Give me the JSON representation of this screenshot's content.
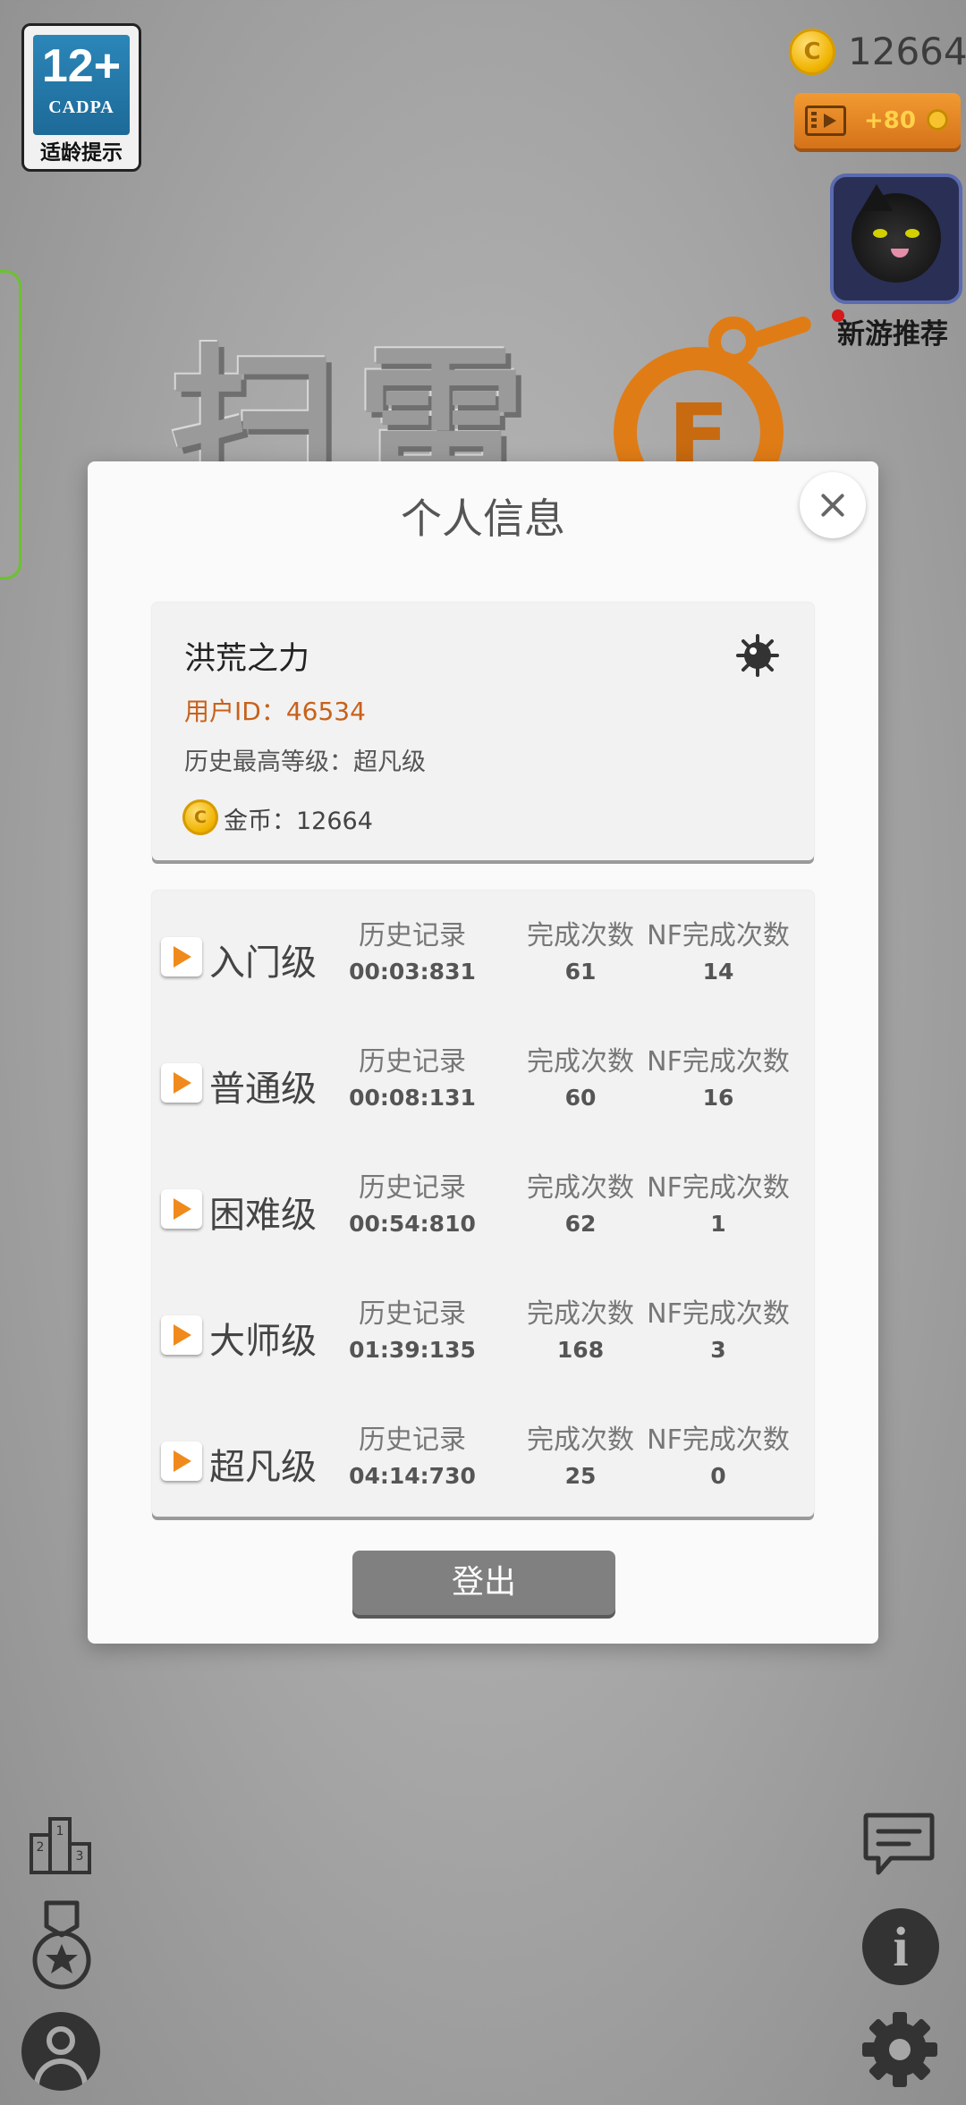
{
  "age_badge": {
    "rating": "12+",
    "org": "CADPA",
    "label": "适龄提示"
  },
  "top_right": {
    "coin_symbol": "C",
    "coins": "12664",
    "ad_reward": "+80"
  },
  "game_rec": {
    "label": "新游推荐"
  },
  "background": {
    "logo_text": "扫雷",
    "bomb_letter": "F"
  },
  "modal": {
    "title": "个人信息",
    "profile": {
      "nickname": "洪荒之力",
      "user_id": "用户ID：46534",
      "highest_level": "历史最高等级：超凡级",
      "coin_symbol": "C",
      "coins": "金币：12664"
    },
    "columns": {
      "record": "历史记录",
      "completions": "完成次数",
      "nf_completions": "NF完成次数"
    },
    "levels": [
      {
        "name": "入门级",
        "record": "00:03:831",
        "completions": "61",
        "nf": "14"
      },
      {
        "name": "普通级",
        "record": "00:08:131",
        "completions": "60",
        "nf": "16"
      },
      {
        "name": "困难级",
        "record": "00:54:810",
        "completions": "62",
        "nf": "1"
      },
      {
        "name": "大师级",
        "record": "01:39:135",
        "completions": "168",
        "nf": "3"
      },
      {
        "name": "超凡级",
        "record": "04:14:730",
        "completions": "25",
        "nf": "0"
      }
    ],
    "logout_label": "登出"
  },
  "bottom_icons": {
    "rank_numbers": [
      "1",
      "2",
      "3"
    ]
  }
}
